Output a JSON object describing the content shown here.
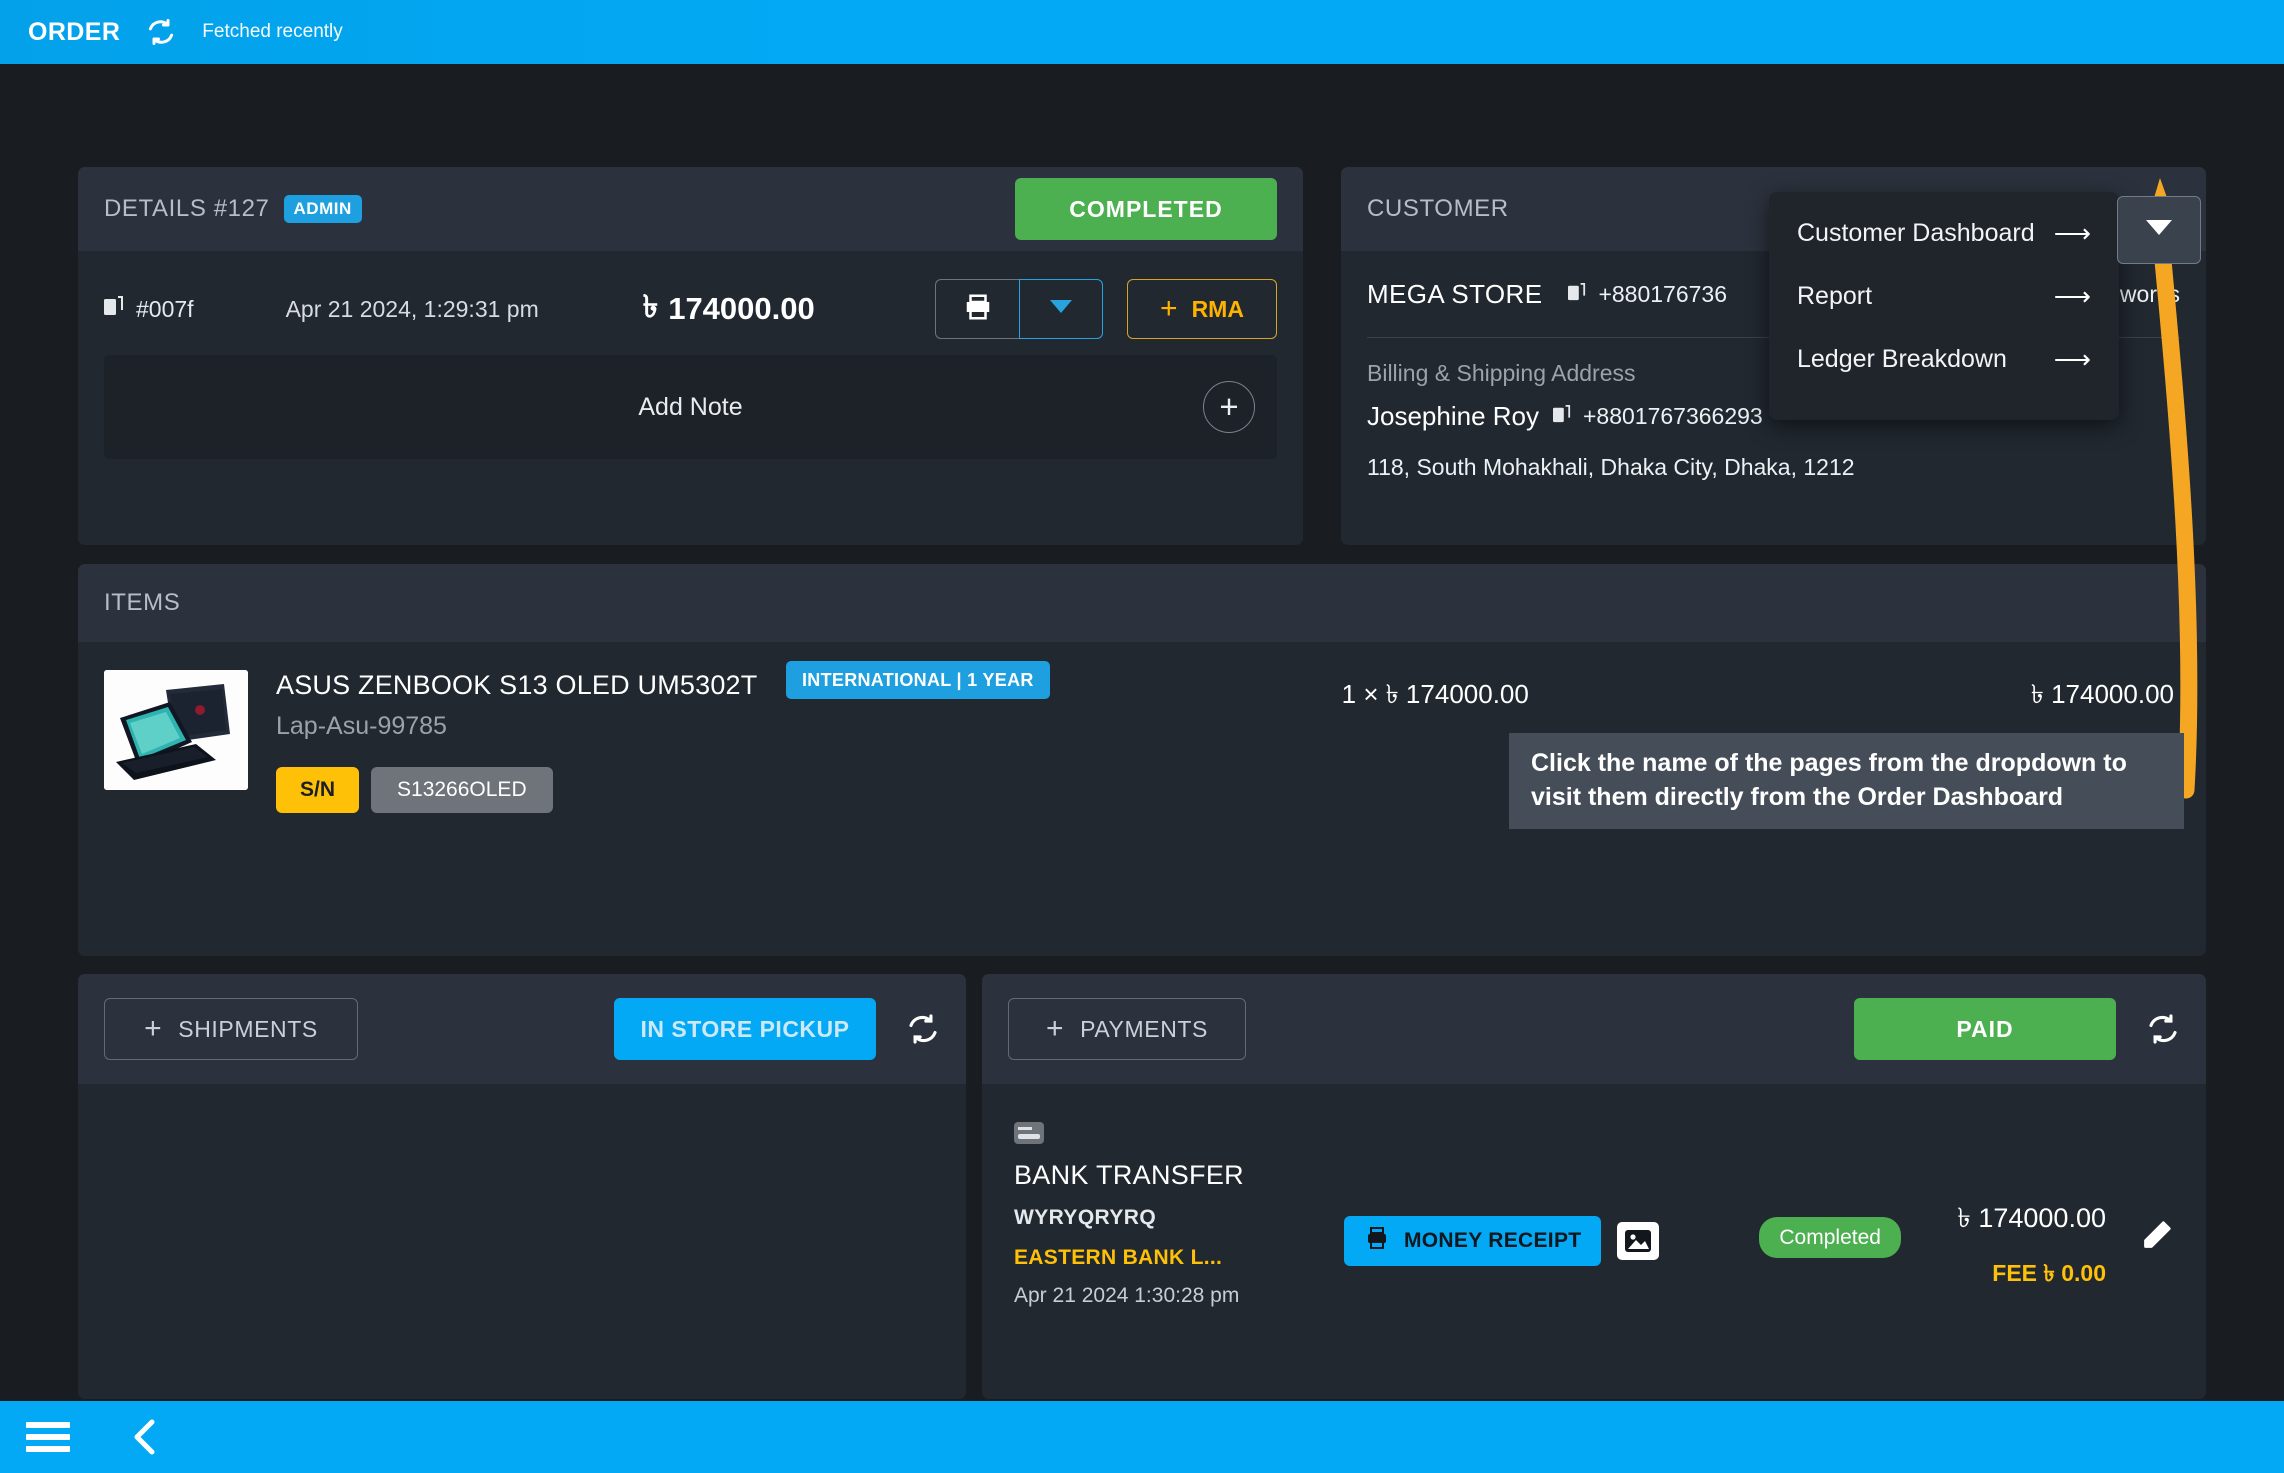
{
  "topbar": {
    "title": "ORDER",
    "sync_icon": "sync-icon",
    "status": "Fetched recently"
  },
  "details": {
    "header_title": "DETAILS #127",
    "admin_badge": "ADMIN",
    "status_button": "COMPLETED",
    "order_code": "#007f",
    "copy_icon": "copy-icon",
    "date": "Apr 21 2024, 1:29:31 pm",
    "currency": "৳",
    "amount": "174000.00",
    "print_icon": "printer-icon",
    "dropdown_icon": "caret-down-icon",
    "rma_button": "RMA",
    "rma_plus_icon": "plus-icon",
    "add_note_label": "Add Note",
    "add_note_plus_icon": "plus-icon"
  },
  "customer": {
    "header_title": "CUSTOMER",
    "store_name": "MEGA STORE",
    "copy_icon": "copy-icon",
    "phone": "+880176736",
    "email_fragment": "n.works",
    "billing_label": "Billing & Shipping Address",
    "contact_name": "Josephine Roy",
    "contact_phone": "+8801767366293",
    "address": "118, South Mohakhali, Dhaka City, Dhaka, 1212",
    "dropdown_trigger_icon": "caret-down-icon",
    "menu": [
      {
        "label": "Customer Dashboard",
        "arrow_icon": "arrow-right-icon"
      },
      {
        "label": "Report",
        "arrow_icon": "arrow-right-icon"
      },
      {
        "label": "Ledger Breakdown",
        "arrow_icon": "arrow-right-icon"
      }
    ]
  },
  "items": {
    "header_title": "ITEMS",
    "rows": [
      {
        "thumbnail": "laptop-product-image",
        "title": "ASUS ZENBOOK S13 OLED UM5302T",
        "sku": "Lap-Asu-99785",
        "warranty_tag": "INTERNATIONAL | 1 YEAR",
        "sn_label": "S/N",
        "serial": "S13266OLED",
        "unit_price": "1 × ৳ 174000.00",
        "line_total": "৳ 174000.00"
      }
    ]
  },
  "callout": {
    "text": "Click the name of the pages from the dropdown to visit them directly from the Order Dashboard",
    "arrow_color": "#f5a623"
  },
  "shipments": {
    "add_button": "SHIPMENTS",
    "add_icon": "plus-icon",
    "status_button": "IN STORE PICKUP",
    "refresh_icon": "sync-icon"
  },
  "payments": {
    "add_button": "PAYMENTS",
    "add_icon": "plus-icon",
    "status_button": "PAID",
    "refresh_icon": "sync-icon",
    "rows": [
      {
        "method_icon": "card-icon",
        "method": "BANK TRANSFER",
        "reference": "WYRYQRYRQ",
        "bank": "EASTERN BANK L...",
        "date": "Apr 21 2024 1:30:28 pm",
        "receipt_button": "MONEY RECEIPT",
        "receipt_icon": "printer-icon",
        "image_icon": "image-icon",
        "status": "Completed",
        "amount": "৳ 174000.00",
        "fee": "FEE ৳ 0.00",
        "edit_icon": "pencil-icon"
      }
    ]
  },
  "bottombar": {
    "menu_icon": "hamburger-menu-icon",
    "back_icon": "chevron-left-icon"
  },
  "colors": {
    "accent_blue": "#03a9f4",
    "success_green": "#4caf50",
    "warning_yellow": "#ffc107",
    "callout_arrow": "#f5a623",
    "card_bg": "#212830",
    "card_head_bg": "#2c323d",
    "page_bg": "#191d21"
  }
}
